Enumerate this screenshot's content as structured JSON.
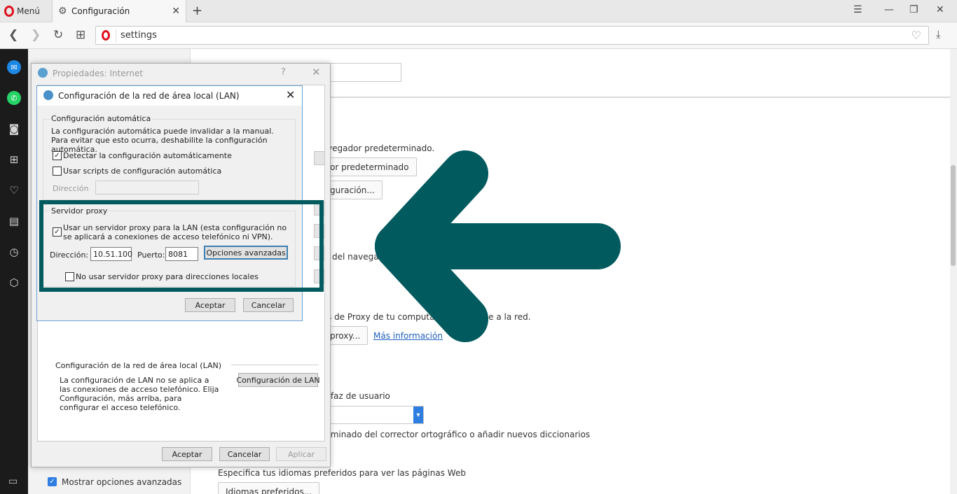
{
  "browser": {
    "menu_label": "Menú",
    "tab_title": "Configuración",
    "url": "settings"
  },
  "settings_bg": {
    "line_default_browser": "vegador predeterminado.",
    "btn_make_default": "or predeterminado",
    "btn_config": "guración...",
    "line_browser": "del navegad",
    "line_proxy": "s de Proxy de tu computad",
    "line_proxy_end": "rse a la red.",
    "btn_proxy": "proxy...",
    "link_more_info": "Más información",
    "line_interface": "rfaz de usuario",
    "line_spell": "rminado del corrector ortográfico o añadir nuevos diccionarios",
    "line_languages": "Especifica tus idiomas preferidos para ver las páginas Web",
    "btn_languages": "Idiomas preferidos...",
    "show_advanced": "Mostrar opciones avanzadas"
  },
  "inet_dialog": {
    "title": "Propiedades: Internet",
    "help": "?",
    "lan_section_label": "Configuración de la red de área local (LAN)",
    "lan_section_desc": "La configuración de LAN no se aplica a las conexiones de acceso telefónico. Elija Configuración, más arriba, para configurar el acceso telefónico.",
    "btn_lan_settings": "Configuración de LAN",
    "btn_ok": "Aceptar",
    "btn_cancel": "Cancelar",
    "btn_apply": "Aplicar"
  },
  "lan_dialog": {
    "title": "Configuración de la red de área local (LAN)",
    "auto_group_label": "Configuración automática",
    "auto_desc": "La configuración automática puede invalidar a la manual. Para evitar que esto ocurra, deshabilite la configuración automática.",
    "detect_auto_label": "Detectar la configuración automáticamente",
    "detect_auto_checked": true,
    "use_script_label": "Usar scripts de configuración automática",
    "use_script_checked": false,
    "address_label": "Dirección",
    "proxy_group_label": "Servidor proxy",
    "use_proxy_label": "Usar un servidor proxy para la LAN (esta configuración no se aplicará a conexiones de acceso telefónico ni VPN).",
    "use_proxy_checked": true,
    "proxy_address_label": "Dirección:",
    "proxy_address_value": "10.51.100",
    "port_label": "Puerto:",
    "port_value": "8081",
    "btn_advanced": "Opciones avanzadas",
    "bypass_local_label": "No usar servidor proxy para direcciones locales",
    "bypass_local_checked": false,
    "btn_ok": "Aceptar",
    "btn_cancel": "Cancelar"
  },
  "colors": {
    "highlight": "#005a5e",
    "arrow": "#005a5e",
    "opera_red": "#e0121f"
  },
  "icons": {
    "sidebar": [
      "messenger-icon",
      "whatsapp-icon",
      "camera-icon",
      "speed-dial-icon",
      "heart-icon",
      "news-icon",
      "history-icon",
      "extensions-icon"
    ]
  }
}
